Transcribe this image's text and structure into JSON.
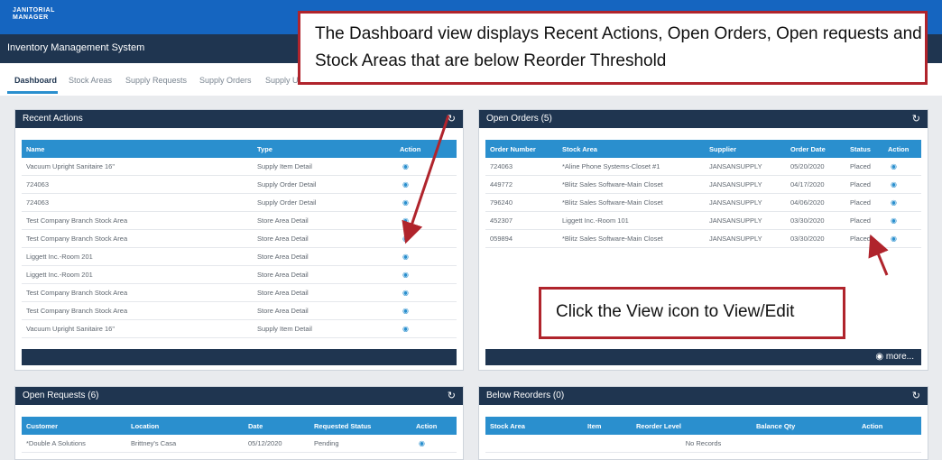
{
  "app": {
    "logo_line1": "JANITORIAL",
    "logo_line2": "MANAGER",
    "title": "Inventory Management System"
  },
  "tabs": [
    {
      "label": "Dashboard",
      "active": true
    },
    {
      "label": "Stock Areas"
    },
    {
      "label": "Supply Requests"
    },
    {
      "label": "Supply Orders"
    },
    {
      "label": "Supply U"
    }
  ],
  "recent_actions": {
    "title": "Recent Actions",
    "columns": [
      "Name",
      "Type",
      "Action"
    ],
    "rows": [
      {
        "name": "Vacuum Upright Sanitaire 16\"",
        "type": "Supply Item Detail"
      },
      {
        "name": "724063",
        "type": "Supply Order Detail"
      },
      {
        "name": "724063",
        "type": "Supply Order Detail"
      },
      {
        "name": "Test Company Branch Stock Area",
        "type": "Store Area Detail"
      },
      {
        "name": "Test Company Branch Stock Area",
        "type": "Store Area Detail"
      },
      {
        "name": "Liggett Inc.-Room 201",
        "type": "Store Area Detail"
      },
      {
        "name": "Liggett Inc.-Room 201",
        "type": "Store Area Detail"
      },
      {
        "name": "Test Company Branch Stock Area",
        "type": "Store Area Detail"
      },
      {
        "name": "Test Company Branch Stock Area",
        "type": "Store Area Detail"
      },
      {
        "name": "Vacuum Upright Sanitaire 16\"",
        "type": "Supply Item Detail"
      }
    ]
  },
  "open_orders": {
    "title": "Open Orders (5)",
    "columns": [
      "Order Number",
      "Stock Area",
      "Supplier",
      "Order Date",
      "Status",
      "Action"
    ],
    "rows": [
      {
        "order": "724063",
        "area": "*Aline Phone Systems-Closet #1",
        "supplier": "JANSANSUPPLY",
        "date": "05/20/2020",
        "status": "Placed"
      },
      {
        "order": "449772",
        "area": "*Blitz Sales Software-Main Closet",
        "supplier": "JANSANSUPPLY",
        "date": "04/17/2020",
        "status": "Placed"
      },
      {
        "order": "796240",
        "area": "*Blitz Sales Software-Main Closet",
        "supplier": "JANSANSUPPLY",
        "date": "04/06/2020",
        "status": "Placed"
      },
      {
        "order": "452307",
        "area": "Liggett Inc.-Room 101",
        "supplier": "JANSANSUPPLY",
        "date": "03/30/2020",
        "status": "Placed"
      },
      {
        "order": "059894",
        "area": "*Blitz Sales Software-Main Closet",
        "supplier": "JANSANSUPPLY",
        "date": "03/30/2020",
        "status": "Placed"
      }
    ],
    "more_label": "more..."
  },
  "open_requests": {
    "title": "Open Requests (6)",
    "columns": [
      "Customer",
      "Location",
      "Date",
      "Requested Status",
      "Action"
    ],
    "rows": [
      {
        "customer": "*Double A Solutions",
        "location": "Brittney's Casa",
        "date": "05/12/2020",
        "status": "Pending"
      }
    ]
  },
  "below_reorders": {
    "title": "Below Reorders (0)",
    "columns": [
      "Stock Area",
      "Item",
      "Reorder Level",
      "Balance Qty",
      "Action"
    ],
    "empty_text": "No Records"
  },
  "callouts": {
    "dashboard_note": "The Dashboard view displays Recent Actions, Open Orders, Open requests and Stock Areas that are below Reorder Threshold",
    "view_note": "Click the View icon to View/Edit"
  },
  "icons": {
    "view": "eye-icon",
    "refresh": "refresh-icon"
  },
  "colors": {
    "header_blue": "#1565c0",
    "navy": "#1f3550",
    "table_head": "#2a8fce",
    "callout_border": "#b0242c"
  }
}
